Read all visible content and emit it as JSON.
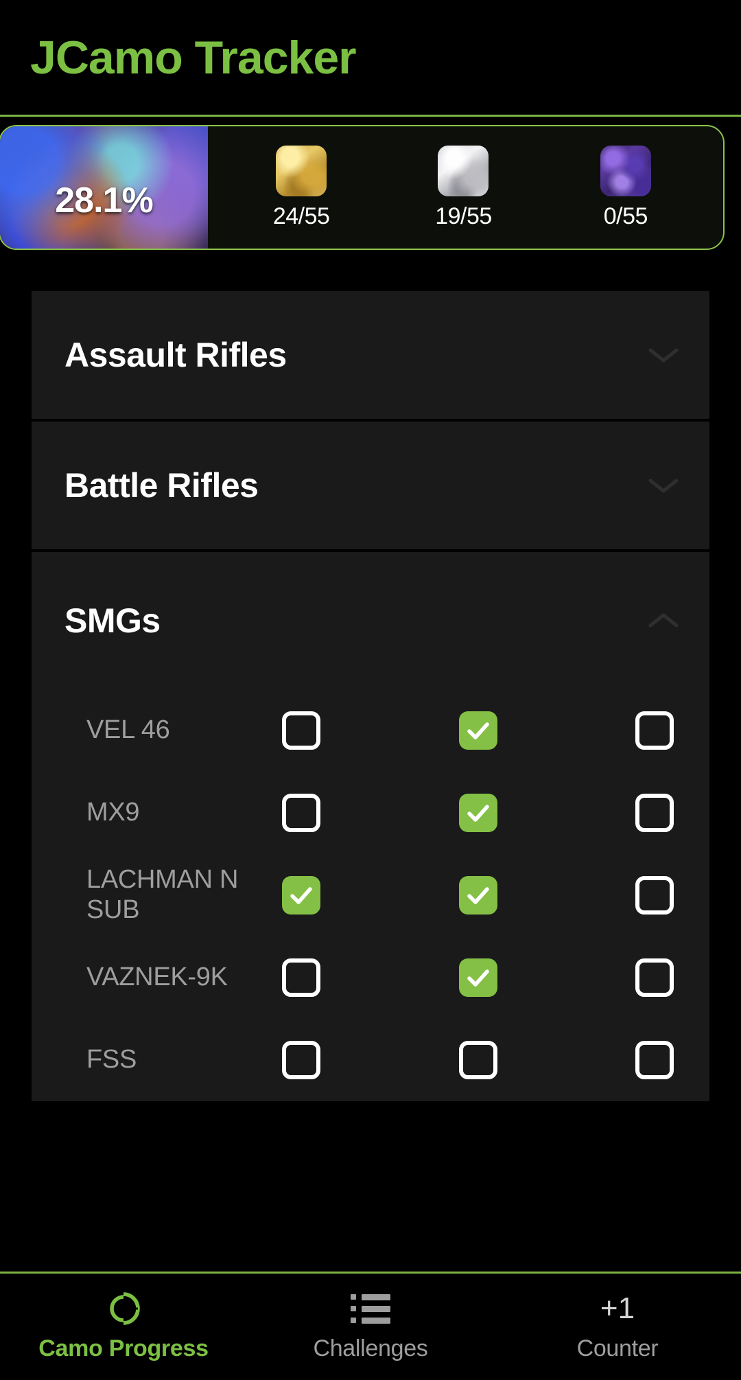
{
  "app": {
    "title": "JCamo Tracker",
    "accent_green": "#7CC043",
    "border_green": "#8BC34A",
    "checkbox_green": "#84c045",
    "background": "#000000",
    "card_background": "#1a1a1a",
    "weapon_name_color": "#9e9e9e"
  },
  "progress": {
    "overall_percent": "28.1%",
    "camos": [
      {
        "name": "gold-camo",
        "swatch": "gold",
        "count": "24/55"
      },
      {
        "name": "platinum-camo",
        "swatch": "platinum",
        "count": "19/55"
      },
      {
        "name": "polyatomic-camo",
        "swatch": "polyatomic",
        "count": "0/55"
      }
    ]
  },
  "categories": [
    {
      "id": "assault-rifles",
      "label": "Assault Rifles",
      "expanded": false,
      "chevron": "chevron-down-icon",
      "weapons": []
    },
    {
      "id": "battle-rifles",
      "label": "Battle Rifles",
      "expanded": false,
      "chevron": "chevron-down-icon",
      "weapons": []
    },
    {
      "id": "smgs",
      "label": "SMGs",
      "expanded": true,
      "chevron": "chevron-up-icon",
      "weapons": [
        {
          "name": "VEL 46",
          "checks": [
            false,
            true,
            false
          ]
        },
        {
          "name": "MX9",
          "checks": [
            false,
            true,
            false
          ]
        },
        {
          "name": "LACHMAN N SUB",
          "checks": [
            true,
            true,
            false
          ]
        },
        {
          "name": "VAZNEK-9K",
          "checks": [
            false,
            true,
            false
          ]
        },
        {
          "name": "FSS",
          "checks": [
            false,
            false,
            false
          ]
        }
      ]
    }
  ],
  "bottom_nav": {
    "items": [
      {
        "id": "camo-progress",
        "label": "Camo Progress",
        "icon": "progress-ring-icon",
        "active": true
      },
      {
        "id": "challenges",
        "label": "Challenges",
        "icon": "list-icon",
        "active": false
      },
      {
        "id": "counter",
        "label": "Counter",
        "icon": "plus-one-icon",
        "glyph": "+1",
        "active": false
      }
    ]
  }
}
